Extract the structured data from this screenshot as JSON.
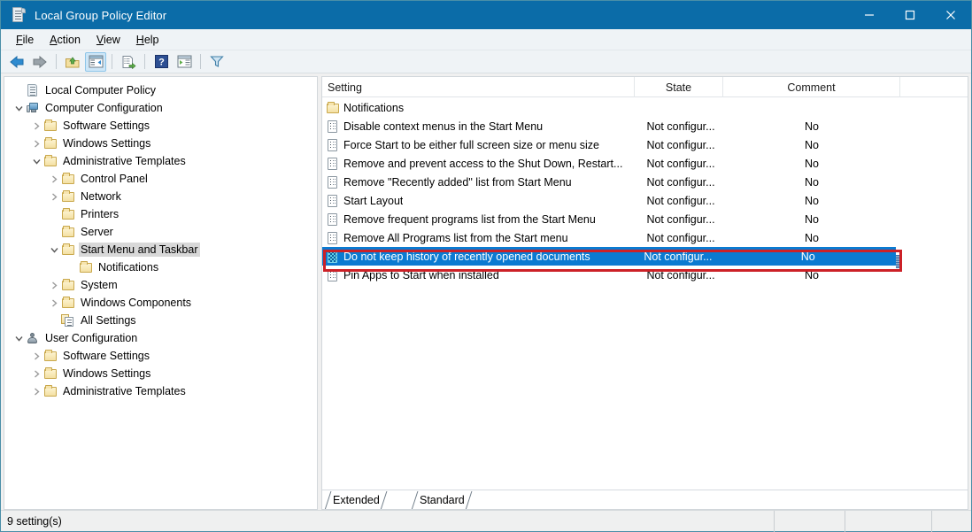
{
  "window": {
    "title": "Local Group Policy Editor",
    "title_icon": "policy-scroll-icon",
    "controls": {
      "minimize": "minimize-icon",
      "maximize": "maximize-icon",
      "close": "close-icon"
    }
  },
  "menubar": {
    "items": [
      {
        "label": "File",
        "accel": "F"
      },
      {
        "label": "Action",
        "accel": "A"
      },
      {
        "label": "View",
        "accel": "V"
      },
      {
        "label": "Help",
        "accel": "H"
      }
    ]
  },
  "toolbar": {
    "buttons": [
      {
        "name": "back-icon",
        "tooltip": "Back"
      },
      {
        "name": "forward-icon",
        "tooltip": "Forward"
      },
      {
        "name": "up-folder-icon",
        "tooltip": "Up One Level"
      },
      {
        "name": "show-hide-tree-icon",
        "tooltip": "Show/Hide Console Tree",
        "pressed": true
      },
      {
        "name": "export-list-icon",
        "tooltip": "Export List"
      },
      {
        "name": "help-icon",
        "tooltip": "Help"
      },
      {
        "name": "properties-icon",
        "tooltip": "Properties"
      },
      {
        "name": "filter-icon",
        "tooltip": "Filter Options"
      }
    ]
  },
  "tree": {
    "items": [
      {
        "label": "Local Computer Policy",
        "icon": "policy-scroll-icon",
        "indent": 0,
        "twisty": "none",
        "selected": false
      },
      {
        "label": "Computer Configuration",
        "icon": "computer-icon",
        "indent": 0,
        "twisty": "expanded",
        "selected": false
      },
      {
        "label": "Software Settings",
        "icon": "folder-icon",
        "indent": 1,
        "twisty": "collapsed",
        "selected": false
      },
      {
        "label": "Windows Settings",
        "icon": "folder-icon",
        "indent": 1,
        "twisty": "collapsed",
        "selected": false
      },
      {
        "label": "Administrative Templates",
        "icon": "folder-icon",
        "indent": 1,
        "twisty": "expanded",
        "selected": false
      },
      {
        "label": "Control Panel",
        "icon": "folder-icon",
        "indent": 2,
        "twisty": "collapsed",
        "selected": false
      },
      {
        "label": "Network",
        "icon": "folder-icon",
        "indent": 2,
        "twisty": "collapsed",
        "selected": false
      },
      {
        "label": "Printers",
        "icon": "folder-icon",
        "indent": 2,
        "twisty": "none",
        "selected": false
      },
      {
        "label": "Server",
        "icon": "folder-icon",
        "indent": 2,
        "twisty": "none",
        "selected": false
      },
      {
        "label": "Start Menu and Taskbar",
        "icon": "folder-icon",
        "indent": 2,
        "twisty": "expanded",
        "selected": true
      },
      {
        "label": "Notifications",
        "icon": "folder-icon",
        "indent": 3,
        "twisty": "none",
        "selected": false
      },
      {
        "label": "System",
        "icon": "folder-icon",
        "indent": 2,
        "twisty": "collapsed",
        "selected": false
      },
      {
        "label": "Windows Components",
        "icon": "folder-icon",
        "indent": 2,
        "twisty": "collapsed",
        "selected": false
      },
      {
        "label": "All Settings",
        "icon": "all-settings-icon",
        "indent": 2,
        "twisty": "none",
        "selected": false
      },
      {
        "label": "User Configuration",
        "icon": "user-icon",
        "indent": 0,
        "twisty": "expanded",
        "selected": false
      },
      {
        "label": "Software Settings",
        "icon": "folder-icon",
        "indent": 1,
        "twisty": "collapsed",
        "selected": false
      },
      {
        "label": "Windows Settings",
        "icon": "folder-icon",
        "indent": 1,
        "twisty": "collapsed",
        "selected": false
      },
      {
        "label": "Administrative Templates",
        "icon": "folder-icon",
        "indent": 1,
        "twisty": "collapsed",
        "selected": false
      }
    ]
  },
  "list": {
    "columns": [
      {
        "label": "Setting"
      },
      {
        "label": "State"
      },
      {
        "label": "Comment"
      }
    ],
    "rows": [
      {
        "setting": "Notifications",
        "icon": "folder-icon",
        "state": "",
        "comment": "",
        "selected": false
      },
      {
        "setting": "Disable context menus in the Start Menu",
        "icon": "policy-icon",
        "state": "Not configur...",
        "comment": "No",
        "selected": false
      },
      {
        "setting": "Force Start to be either full screen size or menu size",
        "icon": "policy-icon",
        "state": "Not configur...",
        "comment": "No",
        "selected": false
      },
      {
        "setting": "Remove and prevent access to the Shut Down, Restart...",
        "icon": "policy-icon",
        "state": "Not configur...",
        "comment": "No",
        "selected": false
      },
      {
        "setting": "Remove \"Recently added\" list from Start Menu",
        "icon": "policy-icon",
        "state": "Not configur...",
        "comment": "No",
        "selected": false
      },
      {
        "setting": "Start Layout",
        "icon": "policy-icon",
        "state": "Not configur...",
        "comment": "No",
        "selected": false
      },
      {
        "setting": "Remove frequent programs list from the Start Menu",
        "icon": "policy-icon",
        "state": "Not configur...",
        "comment": "No",
        "selected": false
      },
      {
        "setting": "Remove All Programs list from the Start menu",
        "icon": "policy-icon",
        "state": "Not configur...",
        "comment": "No",
        "selected": false
      },
      {
        "setting": "Do not keep history of recently opened documents",
        "icon": "policy-icon",
        "state": "Not configur...",
        "comment": "No",
        "selected": true
      },
      {
        "setting": "Pin Apps to Start when installed",
        "icon": "policy-icon",
        "state": "Not configur...",
        "comment": "No",
        "selected": false
      }
    ]
  },
  "tabs": [
    {
      "label": "Extended",
      "active": false
    },
    {
      "label": "Standard",
      "active": true
    }
  ],
  "statusbar": {
    "text": "9 setting(s)"
  },
  "colors": {
    "titlebar": "#0b6ca8",
    "selection": "#0b7ad1",
    "annotation": "#cc2127",
    "window_border": "#4a8fa8",
    "chrome": "#eff3f6"
  }
}
